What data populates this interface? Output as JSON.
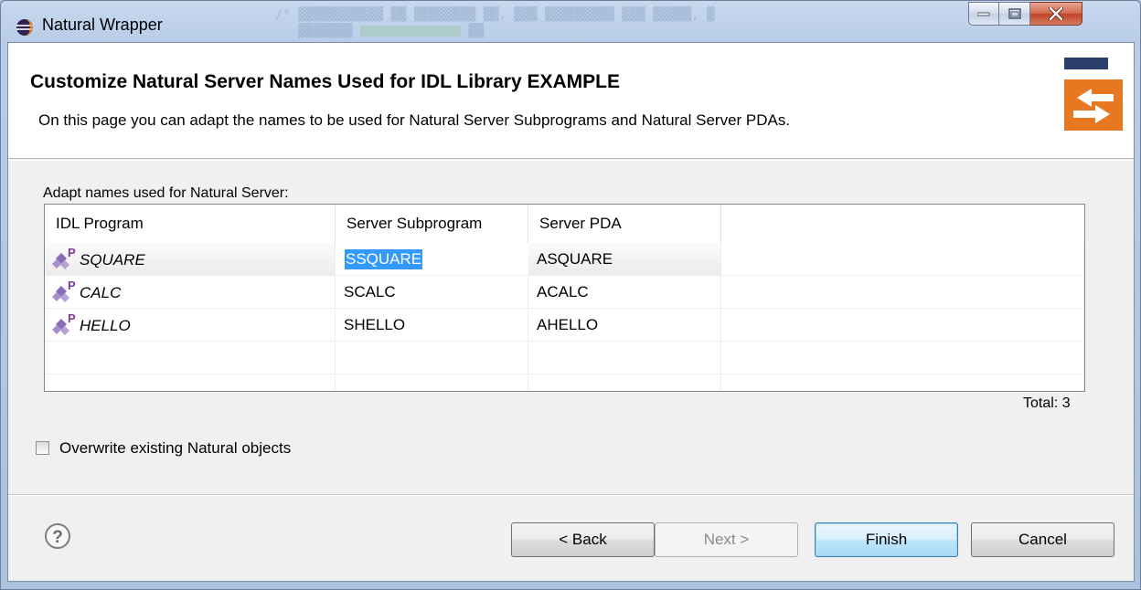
{
  "window": {
    "title": "Natural Wrapper"
  },
  "header": {
    "title": "Customize Natural Server Names Used for IDL Library EXAMPLE",
    "description": "On this page you can adapt the names to be used for Natural Server Subprograms and Natural Server PDAs."
  },
  "table": {
    "label": "Adapt names used for Natural Server:",
    "columns": [
      "IDL Program",
      "Server Subprogram",
      "Server PDA"
    ],
    "rows": [
      {
        "program": "SQUARE",
        "subprogram": "SSQUARE",
        "pda": "ASQUARE"
      },
      {
        "program": "CALC",
        "subprogram": "SCALC",
        "pda": "ACALC"
      },
      {
        "program": "HELLO",
        "subprogram": "SHELLO",
        "pda": "AHELLO"
      }
    ],
    "total": "Total: 3"
  },
  "options": {
    "overwrite_label": "Overwrite existing Natural objects",
    "overwrite_checked": false
  },
  "buttons": {
    "back": "< Back",
    "next": "Next >",
    "finish": "Finish",
    "cancel": "Cancel"
  },
  "icons": {
    "app": "eclipse-icon",
    "banner": "wizard-banner-icon",
    "program": "idl-program-icon",
    "help": "help-icon"
  },
  "colors": {
    "selection": "#3399ff",
    "banner_orange": "#e87722",
    "program_icon_purple": "#7a3a9a"
  }
}
